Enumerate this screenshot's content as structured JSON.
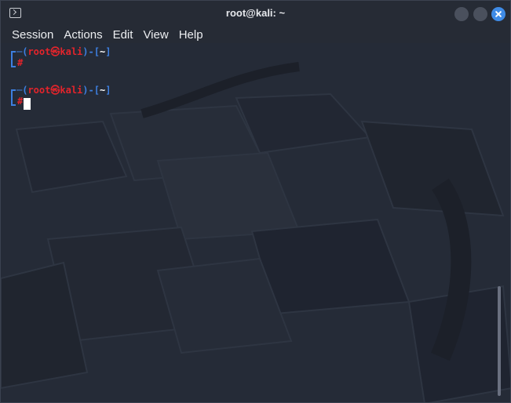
{
  "window": {
    "title": "root@kali: ~",
    "app_icon": "terminal-icon",
    "controls": [
      "minimize",
      "maximize",
      "close"
    ]
  },
  "menu": {
    "items": [
      {
        "label": "Session"
      },
      {
        "label": "Actions"
      },
      {
        "label": "Edit"
      },
      {
        "label": "View"
      },
      {
        "label": "Help"
      }
    ]
  },
  "terminal": {
    "prompts": [
      {
        "open": "─(",
        "user": "root",
        "at": "㉿",
        "host": "kali",
        "mid": ")-[",
        "dir": "~",
        "close": "]",
        "symbol": "#"
      },
      {
        "open": "─(",
        "user": "root",
        "at": "㉿",
        "host": "kali",
        "mid": ")-[",
        "dir": "~",
        "close": "]",
        "symbol": "#"
      }
    ]
  },
  "colors": {
    "background": "#252b37",
    "prompt_frame": "#3d7fe0",
    "prompt_user": "#e3242b",
    "close_button": "#3f8be6"
  }
}
